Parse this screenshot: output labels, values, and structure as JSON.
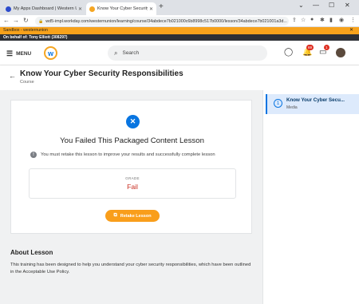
{
  "browser": {
    "tabs": [
      {
        "title": "My Apps Dashboard | Western U",
        "active": false,
        "favicon_color": "#2c4bcc"
      },
      {
        "title": "Know Your Cyber Security Respo",
        "active": true,
        "favicon_color": "#f5a623"
      }
    ],
    "new_tab": "+",
    "url": "wd5-impl.workday.com/westernunion/learning/course/34abdece7b021000c6b8998c517b0000/lesson/34abdece7b021001a3d..."
  },
  "sandbox_banner": "Sandbox - westernunion",
  "behalf_banner": "On behalf of: Tony Elliott (308297)",
  "header": {
    "menu_label": "MENU",
    "logo_letter": "w",
    "search_placeholder": "Search",
    "notifications_count": "69",
    "inbox_count": "1"
  },
  "page": {
    "title": "Know Your Cyber Security Responsibilities",
    "subtitle": "Course"
  },
  "result": {
    "heading": "You Failed This Packaged Content Lesson",
    "message": "You must retake this lesson to improve your results and successfully complete lesson",
    "grade_label": "GRADE",
    "grade_value": "Fail",
    "retake_label": "Retake Lesson"
  },
  "about": {
    "heading": "About Lesson",
    "text": "This training has been designed to help you understand your cyber security responsibilities, which have been outlined in the Acceptable Use Policy."
  },
  "lesson_list": [
    {
      "number": "1",
      "title": "Know Your Cyber Secu...",
      "type": "Media"
    }
  ],
  "colors": {
    "accent": "#0875e1",
    "sandbox": "#f7a21b",
    "retake": "#f99e1b",
    "fail": "#c82b1f"
  }
}
